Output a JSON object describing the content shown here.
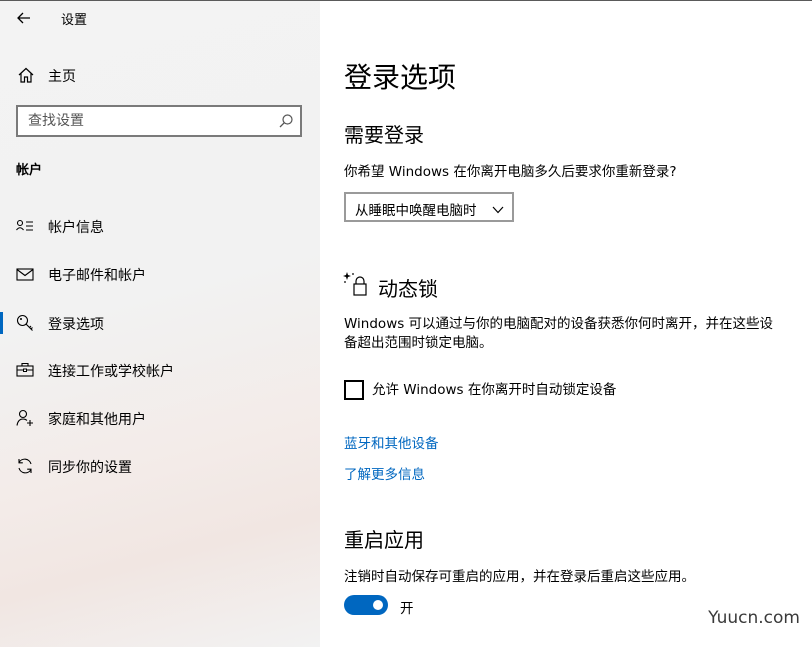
{
  "window": {
    "title": "设置"
  },
  "sidebar": {
    "home_label": "主页",
    "search_placeholder": "查找设置",
    "section_title": "帐户",
    "items": [
      {
        "label": "帐户信息",
        "icon": "account-info-icon",
        "selected": false
      },
      {
        "label": "电子邮件和帐户",
        "icon": "mail-icon",
        "selected": false
      },
      {
        "label": "登录选项",
        "icon": "key-icon",
        "selected": true
      },
      {
        "label": "连接工作或学校帐户",
        "icon": "briefcase-icon",
        "selected": false
      },
      {
        "label": "家庭和其他用户",
        "icon": "add-person-icon",
        "selected": false
      },
      {
        "label": "同步你的设置",
        "icon": "sync-icon",
        "selected": false
      }
    ]
  },
  "main": {
    "title": "登录选项",
    "require_signin": {
      "heading": "需要登录",
      "question": "你希望 Windows 在你离开电脑多久后要求你重新登录?",
      "dropdown_value": "从睡眠中唤醒电脑时"
    },
    "dynamic_lock": {
      "heading": "动态锁",
      "description_line1": "Windows 可以通过与你的电脑配对的设备获悉你何时离开，并在这些设",
      "description_line2": "备超出范围时锁定电脑。",
      "checkbox_label": "允许 Windows 在你离开时自动锁定设备",
      "checkbox_checked": false,
      "link_bluetooth": "蓝牙和其他设备",
      "link_learn_more": "了解更多信息"
    },
    "restart_apps": {
      "heading": "重启应用",
      "description": "注销时自动保存可重启的应用，并在登录后重启这些应用。",
      "toggle_on": true,
      "toggle_label": "开"
    }
  },
  "watermark": "Yuucn.com",
  "colors": {
    "accent": "#0067c0",
    "sidebar_bg": "#f2f2f2"
  }
}
